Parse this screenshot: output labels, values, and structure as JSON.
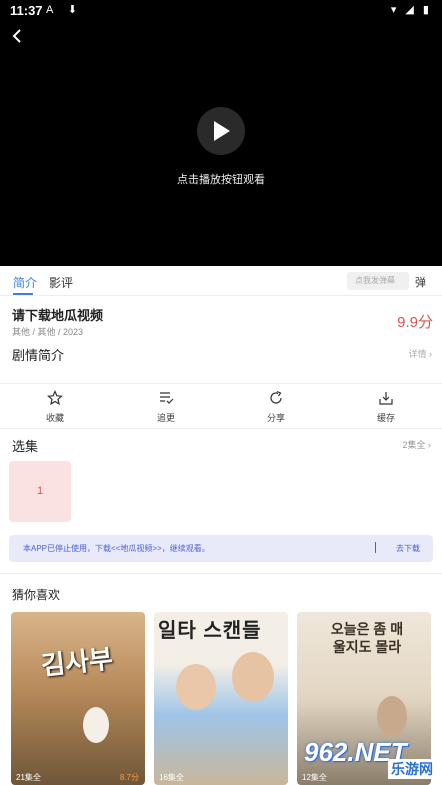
{
  "status_bar": {
    "time": "11:37",
    "left_icons": "A ⬇",
    "right_icons": "▾ ◢ ▮"
  },
  "player": {
    "hint": "点击播放按钮观看"
  },
  "tabs": [
    {
      "label": "简介",
      "active": true
    },
    {
      "label": "影评",
      "active": false
    }
  ],
  "danmaku": {
    "placeholder": "点我发弹幕",
    "icon_text": "弹"
  },
  "video": {
    "title": "请下载地瓜视频",
    "meta": "其他 / 其他 / 2023",
    "score": "9.9分"
  },
  "synopsis": {
    "label": "剧情简介",
    "details": "详情 ›"
  },
  "actions": [
    {
      "label": "收藏",
      "icon": "star-icon"
    },
    {
      "label": "追更",
      "icon": "list-check-icon"
    },
    {
      "label": "分享",
      "icon": "share-icon"
    },
    {
      "label": "缓存",
      "icon": "download-icon"
    }
  ],
  "episodes": {
    "title": "选集",
    "summary": "2集全 ›",
    "items": [
      "1"
    ]
  },
  "notice": {
    "text": "本APP已停止使用，下载<<地瓜视频>>，继续观看。",
    "button": "去下载"
  },
  "recommend": {
    "title": "猜你喜欢",
    "items": [
      {
        "poster_title": "김사부",
        "caption": "21集全",
        "score": "8.7分"
      },
      {
        "poster_title": "일타 스캔들",
        "caption": "16集全",
        "score": ""
      },
      {
        "poster_title": "오늘은 좀 매울지도 몰라",
        "caption": "12集全",
        "score": ""
      }
    ]
  },
  "watermark": {
    "main": "962.NET",
    "sub": "乐游网"
  },
  "colors": {
    "accent": "#3d7fe0",
    "score": "#d9534f",
    "notice": "#4a5fd6"
  }
}
